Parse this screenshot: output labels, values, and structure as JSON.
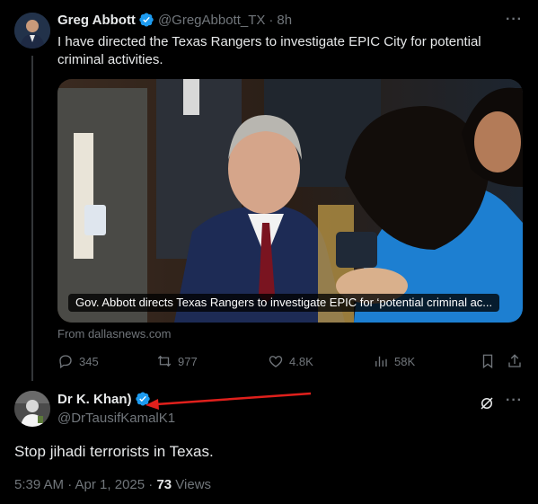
{
  "post": {
    "author_name": "Greg Abbott",
    "author_handle": "@GregAbbott_TX",
    "separator": "·",
    "time": "8h",
    "text": "I have directed the Texas Rangers to investigate EPIC City for potential criminal activities.",
    "card_title": "Gov. Abbott directs Texas Rangers to investigate EPIC for ‘potential criminal ac...",
    "card_source": "From dallasnews.com",
    "stats": {
      "replies": "345",
      "reposts": "977",
      "likes": "4.8K",
      "views": "58K"
    }
  },
  "reply": {
    "author_name": "Dr K. Khan)",
    "author_handle": "@DrTausifKamalK1",
    "text": "Stop jihadi terrorists in Texas.",
    "timestamp": "5:39 AM · Apr 1, 2025 · ",
    "views_count": "73",
    "views_label": " Views"
  },
  "icons": {
    "verified": "verified-badge-icon",
    "more": "more-options-icon",
    "reply": "reply-icon",
    "repost": "repost-icon",
    "like": "heart-icon",
    "views": "views-icon",
    "bookmark": "bookmark-icon",
    "share": "share-icon",
    "grok": "grok-icon"
  },
  "colors": {
    "background": "#000000",
    "text_primary": "#e7e9ea",
    "text_muted": "#71767b",
    "verified_blue": "#1d9bf0",
    "annotation_red": "#e0201c",
    "divider": "#333639"
  }
}
